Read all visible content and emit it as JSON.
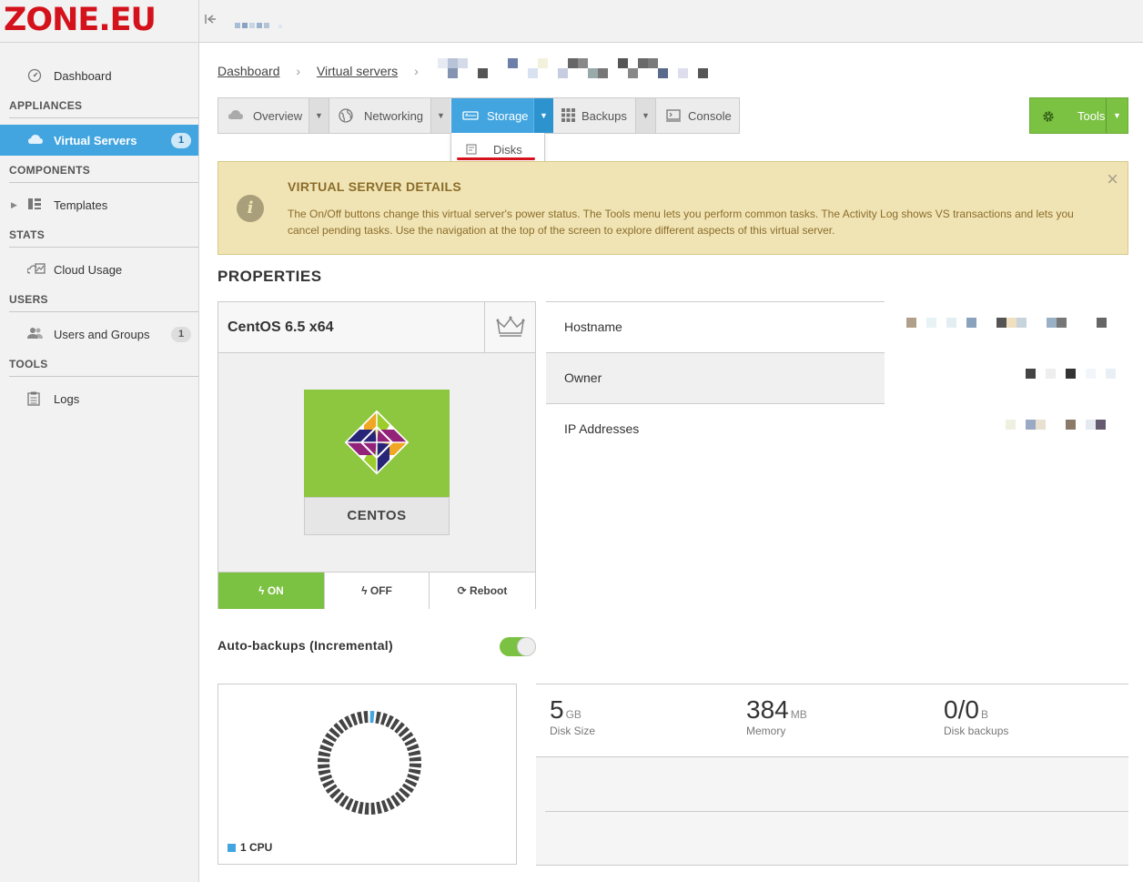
{
  "brand": {
    "logo": "ZONE.EU",
    "color": "#d4121c"
  },
  "sidebar": {
    "dashboard": "Dashboard",
    "sections": {
      "appliances": "APPLIANCES",
      "components": "COMPONENTS",
      "stats": "STATS",
      "users": "USERS",
      "tools": "TOOLS"
    },
    "virtual_servers": {
      "label": "Virtual Servers",
      "badge": "1"
    },
    "templates": "Templates",
    "cloud_usage": "Cloud Usage",
    "users_groups": {
      "label": "Users and Groups",
      "badge": "1"
    },
    "logs": "Logs"
  },
  "breadcrumb": {
    "dashboard": "Dashboard",
    "virtual_servers": "Virtual servers"
  },
  "tabs": {
    "overview": "Overview",
    "networking": "Networking",
    "storage": "Storage",
    "backups": "Backups",
    "console": "Console",
    "storage_menu_disks": "Disks"
  },
  "tools_button": "Tools",
  "info": {
    "title": "VIRTUAL SERVER DETAILS",
    "text": "The On/Off buttons change this virtual server's power status. The Tools menu lets you perform common tasks. The Activity Log shows VS transactions and lets you cancel pending tasks. Use the navigation at the top of the screen to explore different aspects of this virtual server."
  },
  "properties": {
    "title": "PROPERTIES",
    "os_name": "CentOS 6.5 x64",
    "os_label": "CENTOS",
    "power": {
      "on": "ON",
      "off": "OFF",
      "reboot": "Reboot"
    },
    "hostname_label": "Hostname",
    "owner_label": "Owner",
    "ip_label": "IP Addresses"
  },
  "autobackups": {
    "label": "Auto-backups (Incremental)",
    "enabled": true
  },
  "cpu": {
    "legend": "1 CPU",
    "usage_fraction": 0.02
  },
  "stats": {
    "disk": {
      "value": "5",
      "unit": "GB",
      "caption": "Disk Size"
    },
    "memory": {
      "value": "384",
      "unit": "MB",
      "caption": "Memory"
    },
    "backups": {
      "value": "0/0",
      "unit": "B",
      "caption": "Disk backups"
    }
  },
  "colors": {
    "accent": "#42a5e0",
    "success": "#7bc142",
    "info_bg": "#f1e4b4"
  }
}
